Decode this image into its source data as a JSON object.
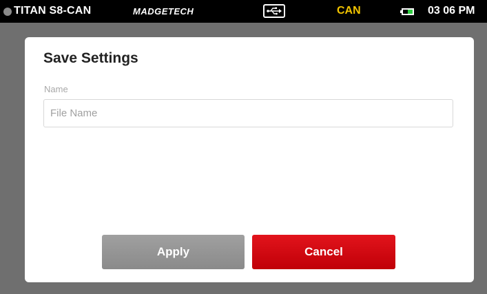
{
  "statusbar": {
    "device_name": "TITAN S8-CAN",
    "brand": "MADGETECH",
    "connection_icon": "usb-icon",
    "mode": "CAN",
    "mode_color": "#f2c400",
    "battery_icon": "battery-icon",
    "battery_level": 0.5,
    "time": "03 06 PM"
  },
  "dialog": {
    "title": "Save Settings",
    "name_label": "Name",
    "name_value": "",
    "name_placeholder": "File Name",
    "apply_label": "Apply",
    "cancel_label": "Cancel",
    "cancel_color": "#d40a12",
    "apply_color": "#969696"
  }
}
